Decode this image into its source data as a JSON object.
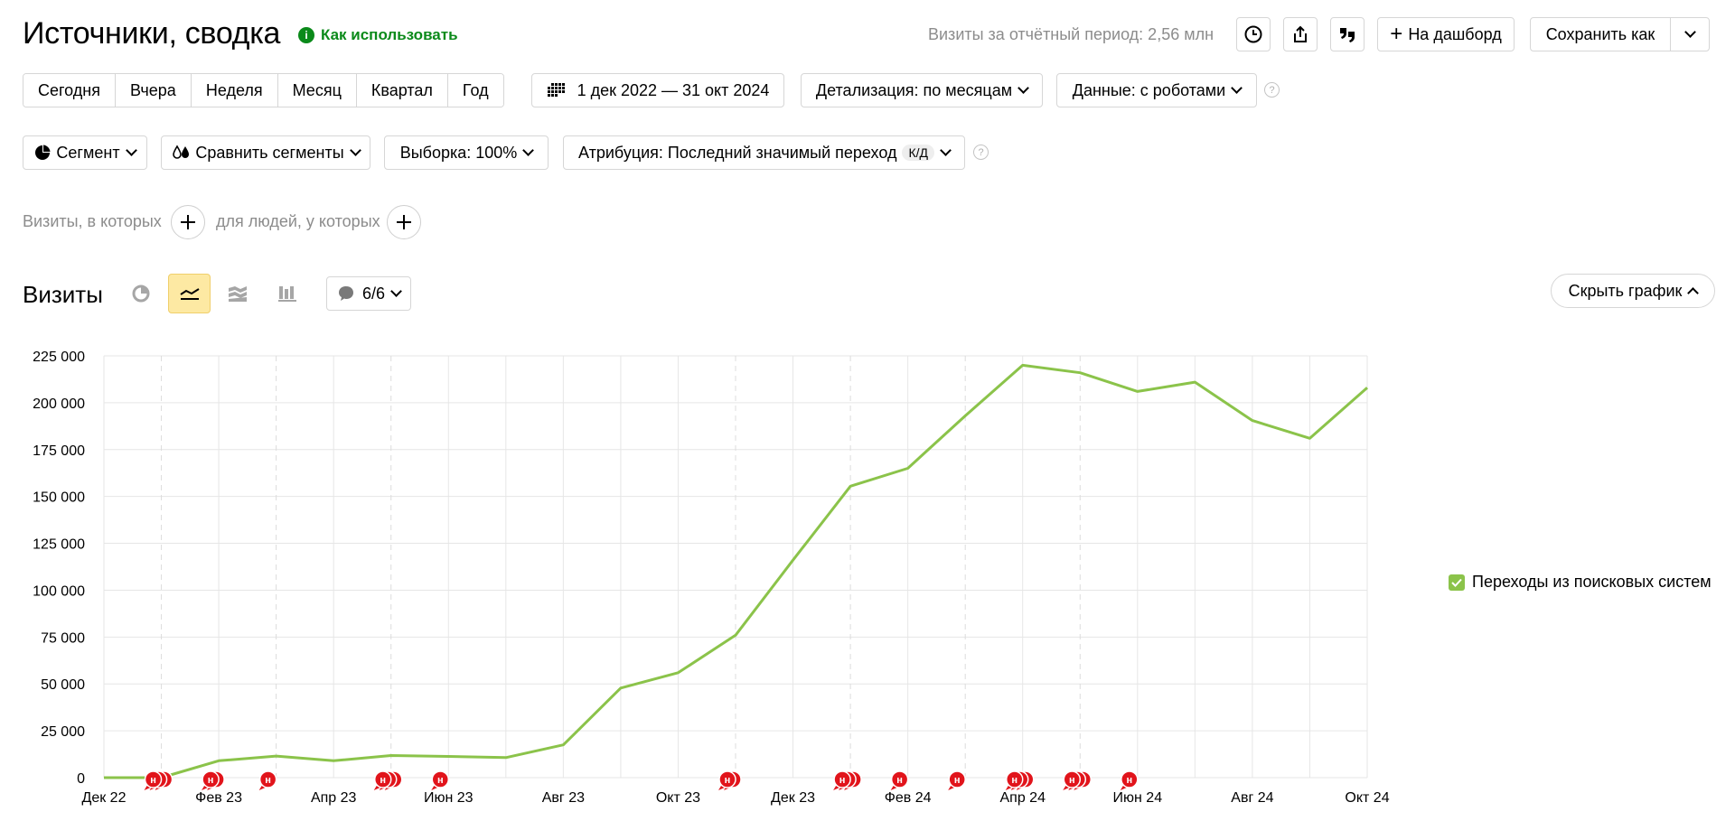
{
  "header": {
    "title": "Источники, сводка",
    "how_to_use": "Как использовать",
    "period_visits": "Визиты за отчётный период: 2,56 млн",
    "dashboard_label": "На дашборд",
    "save_as_label": "Сохранить как"
  },
  "period_tabs": [
    "Сегодня",
    "Вчера",
    "Неделя",
    "Месяц",
    "Квартал",
    "Год"
  ],
  "date_range": "1 дек 2022 — 31 окт 2024",
  "detail": "Детализация: по месяцам",
  "data_mode": "Данные: с роботами",
  "filters": {
    "segment": "Сегмент",
    "compare": "Сравнить сегменты",
    "sample": "Выборка: 100%",
    "attribution": "Атрибуция: Последний значимый переход",
    "attribution_badge": "К/Д"
  },
  "conditions": {
    "visits_where": "Визиты, в которых",
    "people_where": "для людей, у которых"
  },
  "chart_section": {
    "title": "Визиты",
    "notes_counter": "6/6",
    "hide_chart": "Скрыть график"
  },
  "colors": {
    "line": "#8bc34a",
    "accent_yellow": "#fde9a3",
    "note_red": "#e1141b",
    "green_link": "#0b8a1a"
  },
  "chart_data": {
    "type": "line",
    "title": "",
    "xlabel": "",
    "ylabel": "",
    "ylim": [
      0,
      225000
    ],
    "y_ticks": [
      0,
      25000,
      50000,
      75000,
      100000,
      125000,
      150000,
      175000,
      200000,
      225000
    ],
    "y_tick_labels": [
      "0",
      "25 000",
      "50 000",
      "75 000",
      "100 000",
      "125 000",
      "150 000",
      "175 000",
      "200 000",
      "225 000"
    ],
    "x": [
      "Дек 22",
      "Янв 23",
      "Фев 23",
      "Мар 23",
      "Апр 23",
      "Май 23",
      "Июн 23",
      "Июл 23",
      "Авг 23",
      "Сен 23",
      "Окт 23",
      "Ноя 23",
      "Дек 23",
      "Янв 24",
      "Фев 24",
      "Мар 24",
      "Апр 24",
      "Май 24",
      "Июн 24",
      "Июл 24",
      "Авг 24",
      "Сен 24",
      "Окт 24"
    ],
    "x_tick_labels": [
      "Дек 22",
      "",
      "Фев 23",
      "",
      "Апр 23",
      "",
      "Июн 23",
      "",
      "Авг 23",
      "",
      "Окт 23",
      "",
      "Дек 23",
      "",
      "Фев 24",
      "",
      "Апр 24",
      "",
      "Июн 24",
      "",
      "Авг 24",
      "",
      "Окт 24"
    ],
    "dashed_months": [
      1,
      3,
      5,
      11,
      13,
      15,
      17
    ],
    "grid": true,
    "legend_position": "right",
    "series": [
      {
        "name": "Переходы из поисковых систем",
        "color": "#8bc34a",
        "values": [
          0,
          0,
          9000,
          11500,
          9000,
          11800,
          11300,
          10700,
          17500,
          47800,
          56000,
          76000,
          116000,
          155500,
          165000,
          193000,
          220000,
          216000,
          206000,
          211000,
          190500,
          181000,
          208000
        ]
      }
    ],
    "annotations": [
      {
        "month": 1,
        "count": 3,
        "label": "н"
      },
      {
        "month": 2,
        "count": 2,
        "label": "н"
      },
      {
        "month": 3,
        "count": 1,
        "label": "н"
      },
      {
        "month": 5,
        "count": 3,
        "label": "н"
      },
      {
        "month": 6,
        "count": 1,
        "label": "н"
      },
      {
        "month": 11,
        "count": 2,
        "label": "н"
      },
      {
        "month": 13,
        "count": 3,
        "label": "н"
      },
      {
        "month": 14,
        "count": 1,
        "label": "н"
      },
      {
        "month": 15,
        "count": 1,
        "label": "н"
      },
      {
        "month": 16,
        "count": 3,
        "label": "н"
      },
      {
        "month": 17,
        "count": 3,
        "label": "н"
      },
      {
        "month": 18,
        "count": 1,
        "label": "н"
      }
    ]
  }
}
